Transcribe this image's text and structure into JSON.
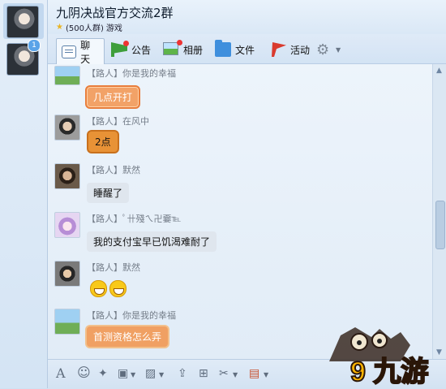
{
  "group": {
    "title": "九阴决战官方交流2群",
    "member_count": "(500人群)",
    "category": "游戏"
  },
  "rail": {
    "badge": "1"
  },
  "tabs": [
    {
      "label": "聊天",
      "icon": "chat-icon",
      "active": true
    },
    {
      "label": "公告",
      "icon": "notice-icon"
    },
    {
      "label": "相册",
      "icon": "album-icon"
    },
    {
      "label": "文件",
      "icon": "folder-icon"
    },
    {
      "label": "活动",
      "icon": "flag-icon"
    }
  ],
  "messages": [
    {
      "sender": "【路人】你是我的幸福",
      "text": "几点开打",
      "style": "orange"
    },
    {
      "sender": "【路人】在风中",
      "text": "2点",
      "style": "gold"
    },
    {
      "sender": "【路人】默然",
      "text": "睡醒了",
      "style": "plain"
    },
    {
      "sender": "【路人】ﾟ卄殘ㄟ卍嫑℡",
      "text": "我的支付宝早已饥渴难耐了",
      "style": "plain"
    },
    {
      "sender": "【路人】默然",
      "text": "",
      "style": "emoji"
    },
    {
      "sender": "【路人】你是我的幸福",
      "text": "首测资格怎么弄",
      "style": "orange"
    }
  ],
  "toolbar_icons": [
    "font-icon",
    "emoji-icon",
    "shake-icon",
    "gift-icon",
    "image-icon",
    "upload-icon",
    "present-icon",
    "scissors-icon",
    "screen-icon"
  ],
  "watermark": {
    "text": "9 九游"
  }
}
